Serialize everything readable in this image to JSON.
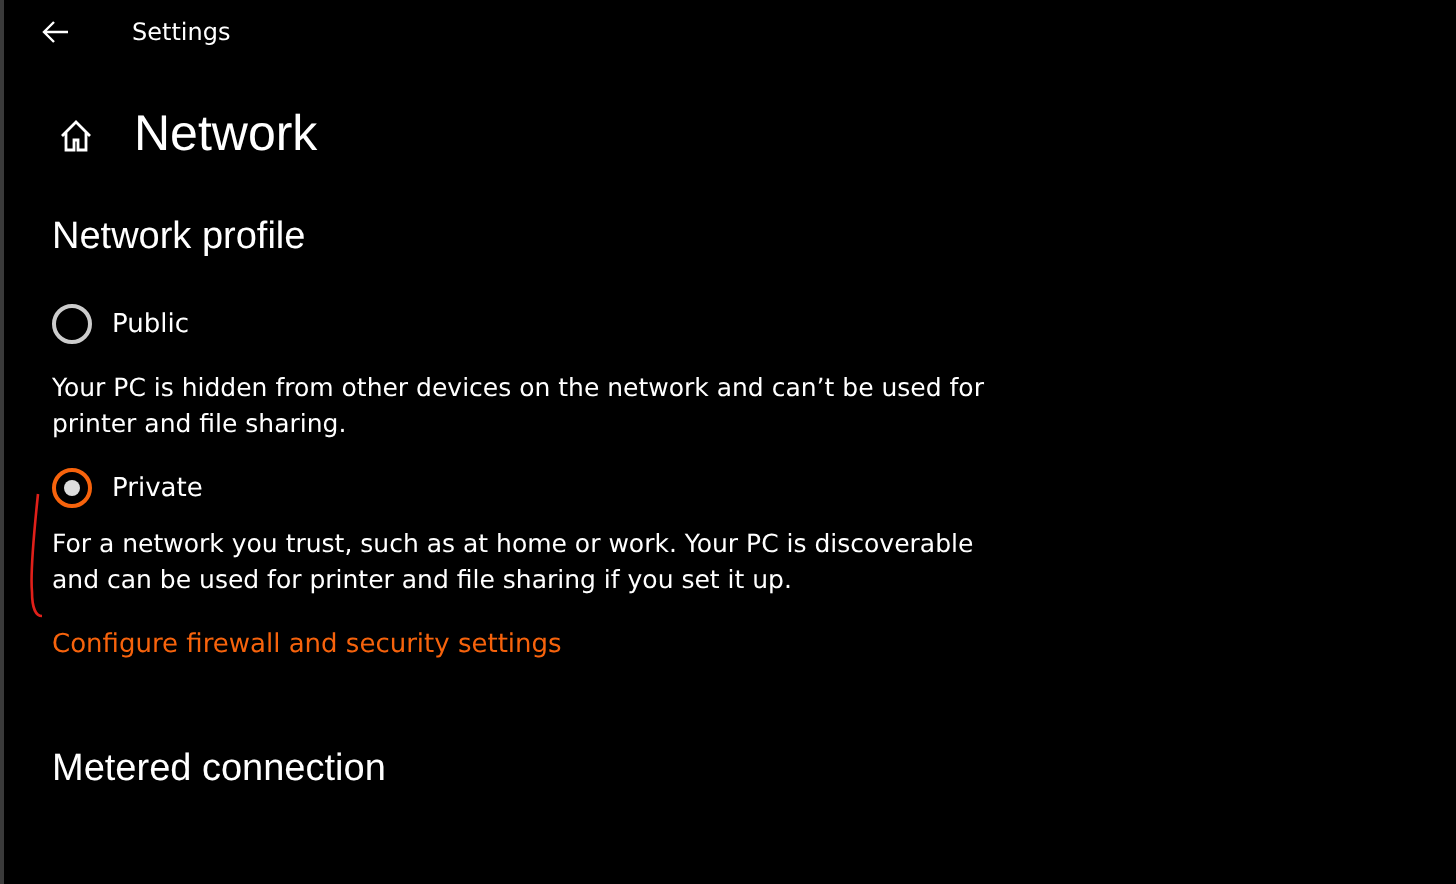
{
  "window": {
    "title": "Settings"
  },
  "page": {
    "title": "Network"
  },
  "section": {
    "title": "Network profile"
  },
  "profiles": [
    {
      "label": "Public",
      "selected": false,
      "description": "Your PC is hidden from other devices on the network and can’t be used for printer and file sharing."
    },
    {
      "label": "Private",
      "selected": true,
      "description": "For a network you trust, such as at home or work. Your PC is discoverable and can be used for printer and file sharing if you set it up."
    }
  ],
  "link": "Configure firewall and security settings",
  "next_section": {
    "title": "Metered connection"
  }
}
